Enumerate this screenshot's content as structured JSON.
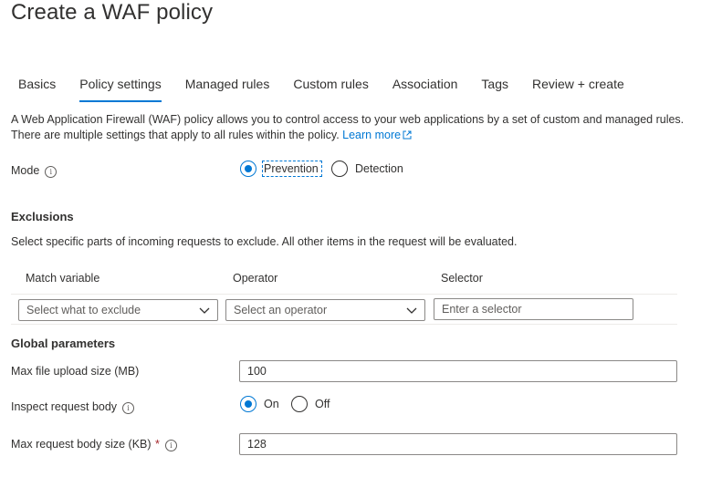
{
  "page": {
    "title": "Create a WAF policy"
  },
  "tabs": [
    {
      "label": "Basics",
      "active": false
    },
    {
      "label": "Policy settings",
      "active": true
    },
    {
      "label": "Managed rules",
      "active": false
    },
    {
      "label": "Custom rules",
      "active": false
    },
    {
      "label": "Association",
      "active": false
    },
    {
      "label": "Tags",
      "active": false
    },
    {
      "label": "Review + create",
      "active": false
    }
  ],
  "description": {
    "text": "A Web Application Firewall (WAF) policy allows you to control access to your web applications by a set of custom and managed rules. There are multiple settings that apply to all rules within the policy.",
    "link_label": "Learn more"
  },
  "mode": {
    "label": "Mode",
    "options": [
      "Prevention",
      "Detection"
    ],
    "selected": "Prevention"
  },
  "exclusions": {
    "title": "Exclusions",
    "description": "Select specific parts of incoming requests to exclude. All other items in the request will be evaluated.",
    "columns": [
      "Match variable",
      "Operator",
      "Selector"
    ],
    "match_variable_placeholder": "Select what to exclude",
    "operator_placeholder": "Select an operator",
    "selector_placeholder": "Enter a selector"
  },
  "global_parameters": {
    "title": "Global parameters",
    "max_file_upload_label": "Max file upload size (MB)",
    "max_file_upload_value": "100",
    "inspect_body_label": "Inspect request body",
    "inspect_body_options": [
      "On",
      "Off"
    ],
    "inspect_body_selected": "On",
    "max_body_label": "Max request body size (KB)",
    "required_marker": "*",
    "max_body_value": "128"
  },
  "colors": {
    "accent": "#0078d4",
    "text": "#323130",
    "border": "#8a8886",
    "required": "#a4262c"
  },
  "icons": [
    "info-icon",
    "external-link-icon",
    "chevron-down-icon"
  ]
}
